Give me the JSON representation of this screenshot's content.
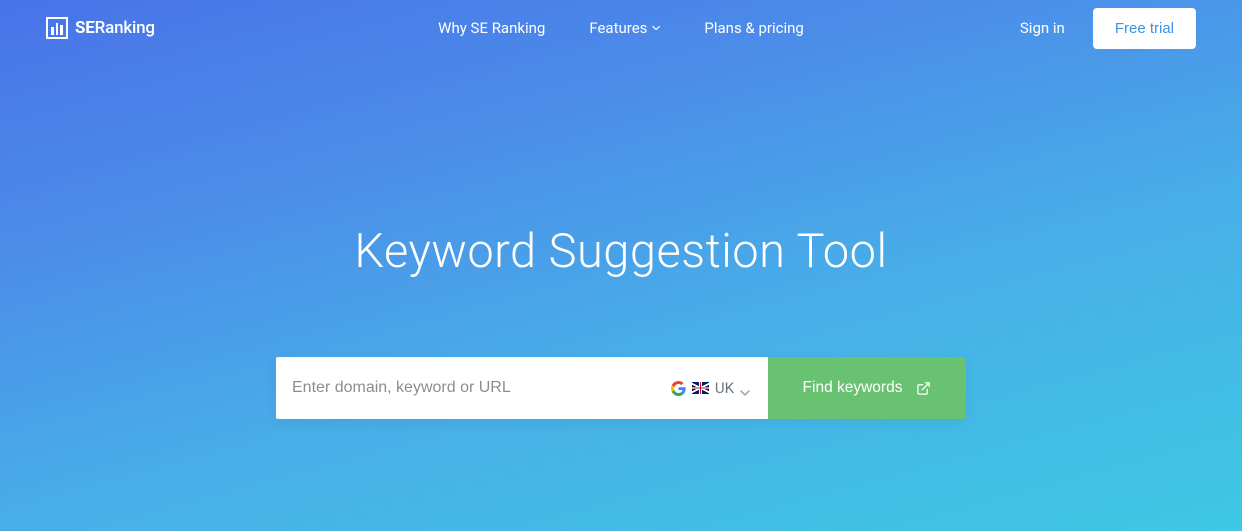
{
  "brand": {
    "prefix": "SE",
    "suffix": "Ranking"
  },
  "nav": {
    "why": "Why SE Ranking",
    "features": "Features",
    "plans": "Plans & pricing"
  },
  "actions": {
    "signin": "Sign in",
    "free_trial": "Free trial"
  },
  "hero": {
    "title": "Keyword Suggestion Tool"
  },
  "search": {
    "placeholder": "Enter domain, keyword or URL",
    "region_label": "UK",
    "button_label": "Find keywords"
  }
}
